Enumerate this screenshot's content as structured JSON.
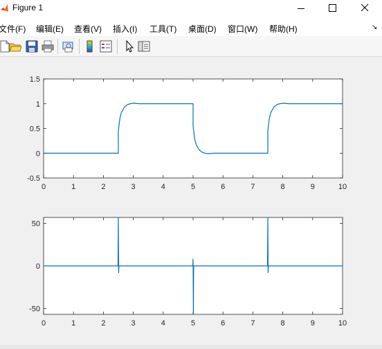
{
  "window": {
    "title": "Figure 1"
  },
  "menu": [
    {
      "label": "文件(F)"
    },
    {
      "label": "编辑(E)"
    },
    {
      "label": "查看(V)"
    },
    {
      "label": "插入(I)"
    },
    {
      "label": "工具(T)"
    },
    {
      "label": "桌面(D)"
    },
    {
      "label": "窗口(W)"
    },
    {
      "label": "帮助(H)"
    }
  ],
  "toolbar": {
    "icons": [
      "new-figure-icon",
      "open-file-icon",
      "save-icon",
      "print-icon",
      "print-preview-icon",
      "colorbar-icon",
      "legend-icon",
      "edit-plot-arrow-icon",
      "property-editor-icon"
    ]
  },
  "colors": {
    "line": "#0072bd",
    "axes_bg": "#ffffff",
    "figure_bg": "#f0f0f0"
  },
  "chart_data": [
    {
      "type": "line",
      "title": "",
      "xlabel": "",
      "ylabel": "",
      "xlim": [
        0,
        10
      ],
      "ylim": [
        -0.5,
        1.5
      ],
      "xticks": [
        "0",
        "1",
        "2",
        "3",
        "4",
        "5",
        "6",
        "7",
        "8",
        "9",
        "10"
      ],
      "yticks": [
        "-0.5",
        "0",
        "0.5",
        "1",
        "1.5"
      ],
      "grid": false,
      "series": [
        {
          "x": [
            0,
            2.5,
            2.5,
            2.55,
            2.6,
            2.7,
            2.8,
            2.9,
            3.0,
            3.2,
            5.0,
            5.0,
            5.05,
            5.1,
            5.2,
            5.3,
            5.4,
            5.5,
            5.7,
            7.5,
            7.5,
            7.55,
            7.6,
            7.7,
            7.8,
            7.9,
            8.0,
            8.2,
            10.0
          ],
          "y": [
            0,
            0,
            0.45,
            0.7,
            0.82,
            0.93,
            0.98,
            1.0,
            1.01,
            1.0,
            1.0,
            0.55,
            0.3,
            0.18,
            0.07,
            0.02,
            0.0,
            -0.01,
            0.0,
            0,
            0.45,
            0.7,
            0.82,
            0.93,
            0.98,
            1.0,
            1.01,
            1.0,
            1.0
          ]
        }
      ]
    },
    {
      "type": "line",
      "title": "",
      "xlabel": "",
      "ylabel": "",
      "xlim": [
        0,
        10
      ],
      "ylim": [
        -57,
        57
      ],
      "xticks": [
        "0",
        "1",
        "2",
        "3",
        "4",
        "5",
        "6",
        "7",
        "8",
        "9",
        "10"
      ],
      "yticks": [
        "-50",
        "0",
        "50"
      ],
      "grid": false,
      "series": [
        {
          "x": [
            0,
            2.49,
            2.5,
            2.51,
            2.52,
            2.53,
            4.99,
            5.0,
            5.01,
            5.02,
            5.03,
            7.49,
            7.5,
            7.51,
            7.52,
            7.53,
            10.0
          ],
          "y": [
            0,
            0,
            57,
            -8,
            0,
            0,
            0,
            8,
            -57,
            0,
            0,
            0,
            57,
            -8,
            0,
            0,
            0
          ]
        }
      ]
    }
  ]
}
